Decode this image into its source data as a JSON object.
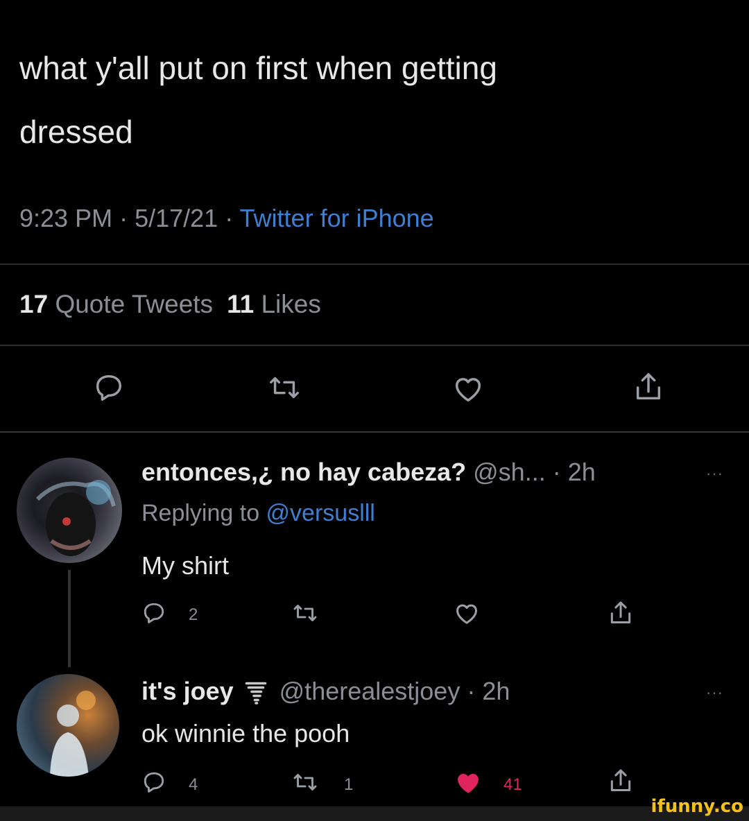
{
  "tweet": {
    "text_line1": "what y'all put on first when getting",
    "text_line2": "dressed",
    "time": "9:23 PM",
    "sep1": " · ",
    "date": "5/17/21",
    "sep2": " · ",
    "source": "Twitter for iPhone"
  },
  "stats": {
    "quote_count": "17",
    "quote_label": "Quote Tweets",
    "like_count": "11",
    "like_label": "Likes"
  },
  "actions": [
    "reply-icon",
    "retweet-icon",
    "like-icon",
    "share-icon"
  ],
  "replies": [
    {
      "display_name": "entonces,¿ no hay cabeza?",
      "handle": "@sh...",
      "time": " · 2h",
      "more": "···",
      "replying_prefix": "Replying to ",
      "replying_handle": "@versuslll",
      "text": "My shirt",
      "reply_count": "2",
      "retweet_count": "",
      "like_count": "",
      "liked": false
    },
    {
      "display_name": "it's joey",
      "handle": "@therealestjoey",
      "time": " · 2h",
      "more": "···",
      "text": "ok winnie the pooh",
      "reply_count": "4",
      "retweet_count": "1",
      "like_count": "41",
      "liked": true
    }
  ],
  "colors": {
    "background": "#000000",
    "text": "#e6e6e6",
    "muted": "#8a8f96",
    "link": "#3f7fd1",
    "like_red": "#e0245e",
    "watermark": "#f4c21a"
  },
  "watermark": "ifunny.co"
}
